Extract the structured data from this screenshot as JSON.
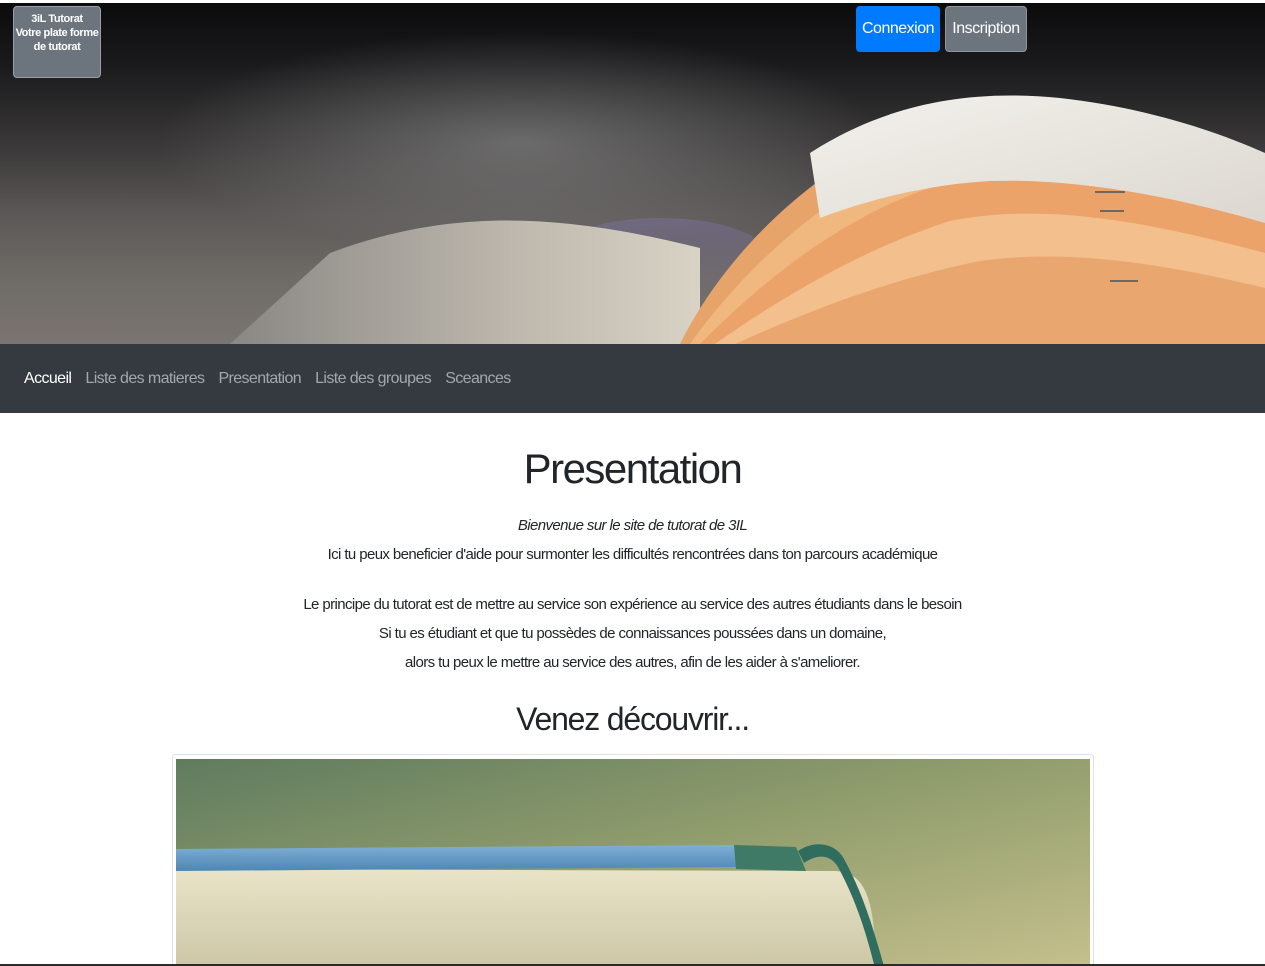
{
  "header": {
    "brand_lines": [
      "3iL Tutorat",
      "Votre plate forme",
      "de tutorat"
    ],
    "buttons": {
      "login_label": "Connexion",
      "signup_label": "Inscription"
    },
    "colors": {
      "login_button": "#007bff",
      "signup_button": "#6c757d"
    }
  },
  "nav": {
    "items": [
      {
        "label": "Accueil",
        "active": true
      },
      {
        "label": "Liste des matieres",
        "active": false
      },
      {
        "label": "Presentation",
        "active": false
      },
      {
        "label": "Liste des groupes",
        "active": false
      },
      {
        "label": "Sceances",
        "active": false
      }
    ],
    "background": "#343a40"
  },
  "main": {
    "title": "Presentation",
    "intro": {
      "welcome": "Bienvenue sur le site de tutorat de 3IL",
      "line": "Ici tu peux beneficier d'aide pour surmonter les difficultés rencontrées dans ton parcours académique"
    },
    "principe": [
      "Le principe du tutorat est de mettre au service son expérience au service des autres étudiants dans le besoin",
      "Si tu es étudiant et que tu possèdes de connaissances poussées dans un domaine,",
      "alors tu peux le mettre au service des autres, afin de les aider à s'ameliorer."
    ],
    "discover_title": "Venez découvrir..."
  }
}
